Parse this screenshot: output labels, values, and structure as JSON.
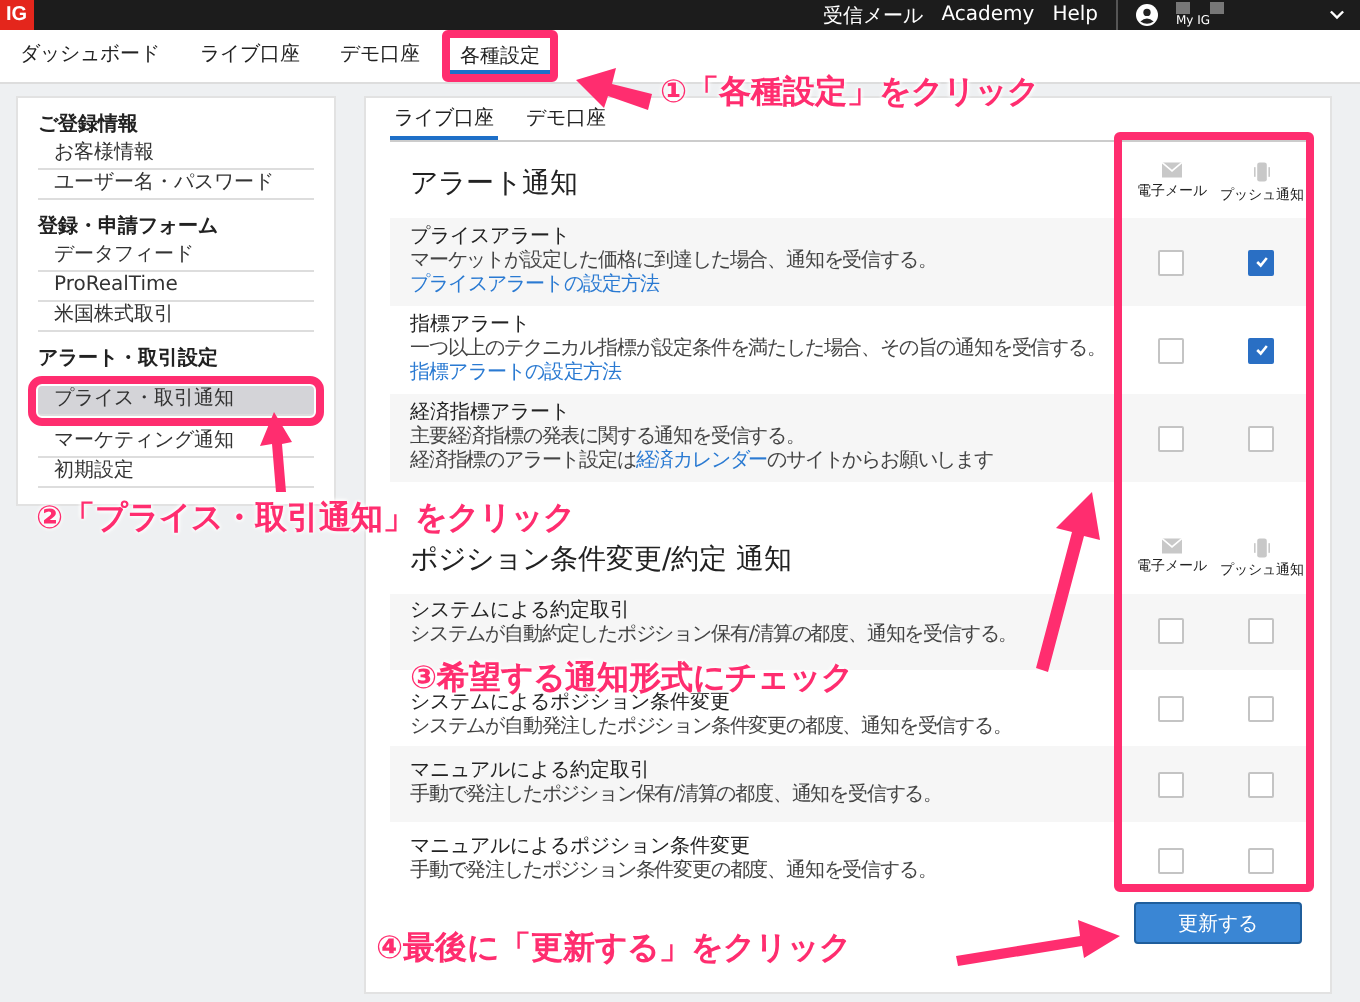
{
  "header": {
    "logo": "IG",
    "links": [
      "受信メール",
      "Academy",
      "Help"
    ],
    "user": "My IG"
  },
  "nav": [
    {
      "label": "ダッシュボード",
      "selected": false,
      "highlighted": false
    },
    {
      "label": "ライブ口座",
      "selected": false,
      "highlighted": false
    },
    {
      "label": "デモ口座",
      "selected": false,
      "highlighted": false
    },
    {
      "label": "各種設定",
      "selected": true,
      "highlighted": true
    }
  ],
  "sidebar": [
    {
      "heading": "ご登録情報",
      "items": [
        {
          "label": "お客様情報",
          "selected": false,
          "highlighted": false
        },
        {
          "label": "ユーザー名・パスワード",
          "selected": false,
          "highlighted": false
        }
      ]
    },
    {
      "heading": "登録・申請フォーム",
      "items": [
        {
          "label": "データフィード",
          "selected": false,
          "highlighted": false
        },
        {
          "label": "ProRealTime",
          "selected": false,
          "highlighted": false
        },
        {
          "label": "米国株式取引",
          "selected": false,
          "highlighted": false
        }
      ]
    },
    {
      "heading": "アラート・取引設定",
      "items": [
        {
          "label": "プライス・取引通知",
          "selected": true,
          "highlighted": true
        },
        {
          "label": "マーケティング通知",
          "selected": false,
          "highlighted": false
        },
        {
          "label": "初期設定",
          "selected": false,
          "highlighted": false
        }
      ]
    }
  ],
  "tabs": [
    {
      "label": "ライブ口座",
      "selected": true
    },
    {
      "label": "デモ口座",
      "selected": false
    }
  ],
  "sections": [
    {
      "title": "アラート通知",
      "columns": [
        "電子メール",
        "プッシュ通知"
      ],
      "rows": [
        {
          "title": "プライスアラート",
          "description": "マーケットが設定した価格に到達した場合、通知を受信する。",
          "link": "プライスアラートの設定方法",
          "email": false,
          "push": true
        },
        {
          "title": "指標アラート",
          "description": "一つ以上のテクニカル指標が設定条件を満たした場合、その旨の通知を受信する。",
          "link": "指標アラートの設定方法",
          "email": false,
          "push": true
        },
        {
          "title": "経済指標アラート",
          "description": "主要経済指標の発表に関する通知を受信する。",
          "note": {
            "before": "経済指標のアラート設定は",
            "link": "経済カレンダー",
            "after": "のサイトからお願いします"
          },
          "email": false,
          "push": false
        }
      ]
    },
    {
      "title": "ポジション条件変更/約定 通知",
      "columns": [
        "電子メール",
        "プッシュ通知"
      ],
      "rows": [
        {
          "title": "システムによる約定取引",
          "description": "システムが自動約定したポジション保有/清算の都度、通知を受信する。",
          "email": false,
          "push": false
        },
        {
          "title": "システムによるポジション条件変更",
          "description": "システムが自動発注したポジション条件変更の都度、通知を受信する。",
          "email": false,
          "push": false
        },
        {
          "title": "マニュアルによる約定取引",
          "description": "手動で発注したポジション保有/清算の都度、通知を受信する。",
          "email": false,
          "push": false
        },
        {
          "title": "マニュアルによるポジション条件変更",
          "description": "手動で発注したポジション条件変更の都度、通知を受信する。",
          "email": false,
          "push": false
        }
      ]
    }
  ],
  "button": "更新する",
  "annotations": [
    "①「各種設定」をクリック",
    "②「プライス・取引通知」をクリック",
    "③希望する通知形式にチェック",
    "④最後に「更新する」をクリック"
  ]
}
